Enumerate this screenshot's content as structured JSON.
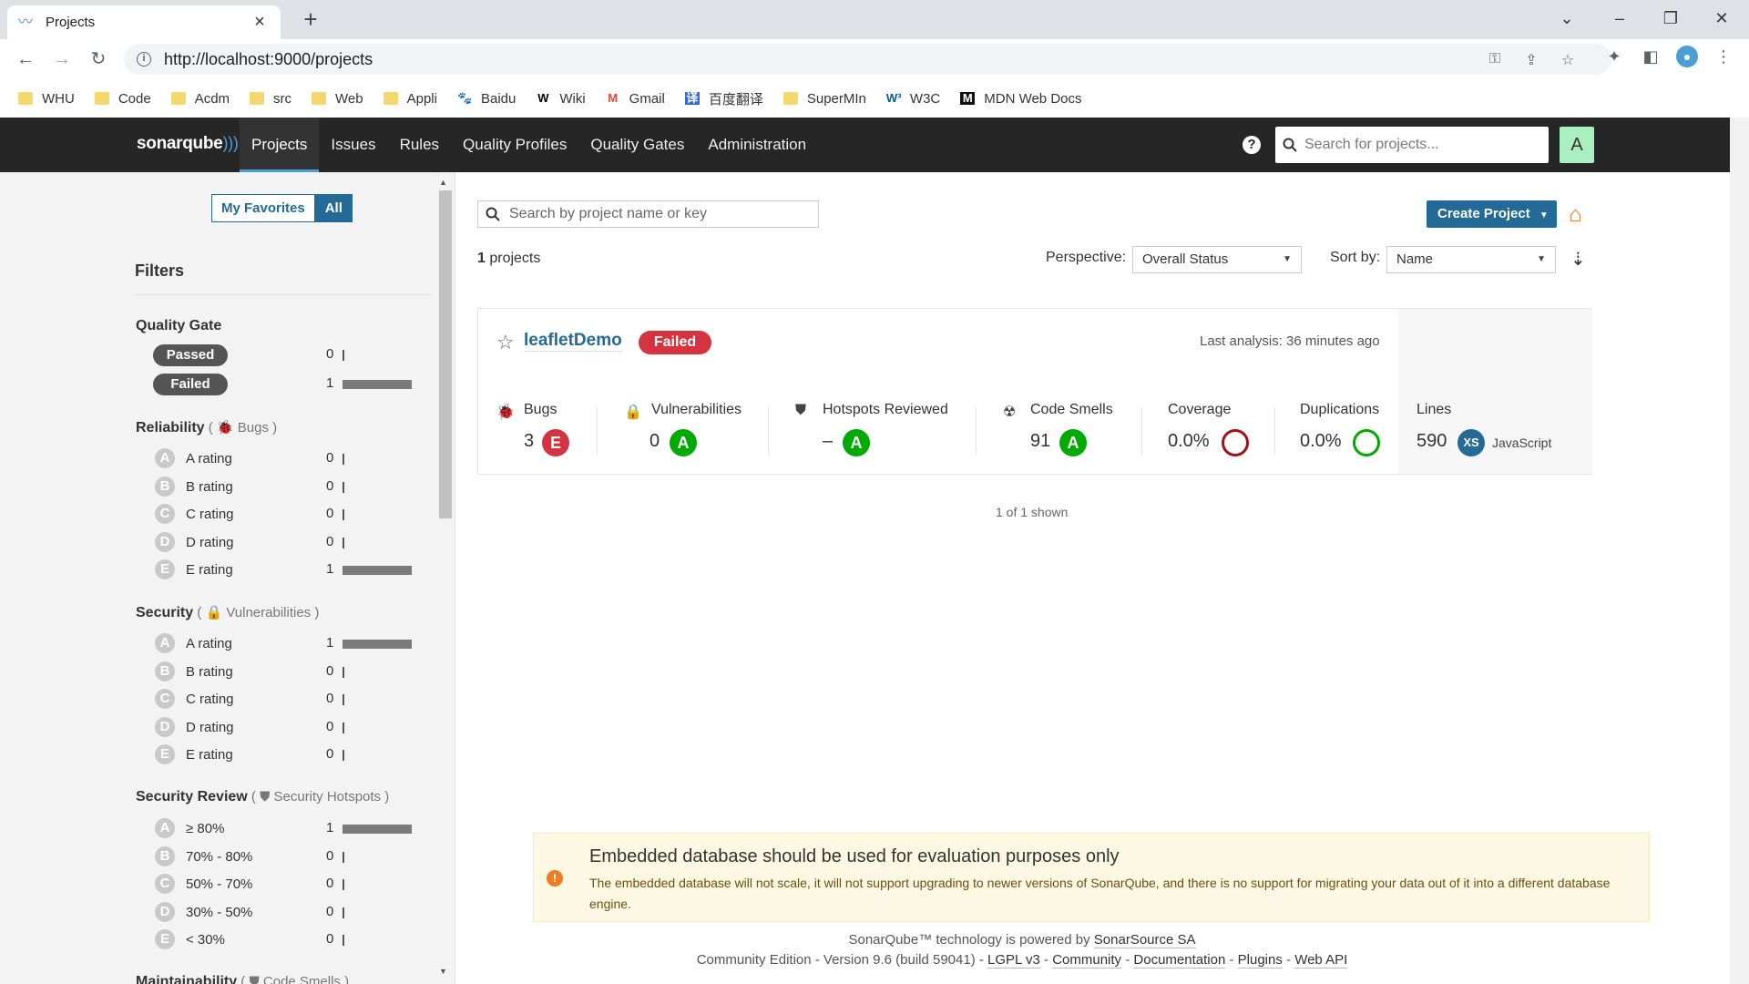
{
  "browser": {
    "tab_title": "Projects",
    "url": "http://localhost:9000/projects",
    "bookmarks": [
      {
        "label": "WHU",
        "icon": "folder-icon"
      },
      {
        "label": "Code",
        "icon": "folder-icon"
      },
      {
        "label": "Acdm",
        "icon": "folder-icon"
      },
      {
        "label": "src",
        "icon": "folder-icon"
      },
      {
        "label": "Web",
        "icon": "folder-icon"
      },
      {
        "label": "Appli",
        "icon": "folder-icon"
      },
      {
        "label": "Baidu",
        "icon": "baidu-icon"
      },
      {
        "label": "Wiki",
        "icon": "wikipedia-icon"
      },
      {
        "label": "Gmail",
        "icon": "gmail-icon"
      },
      {
        "label": "百度翻译",
        "icon": "translate-icon"
      },
      {
        "label": "SuperMIn",
        "icon": "folder-icon"
      },
      {
        "label": "W3C",
        "icon": "w3c-icon"
      },
      {
        "label": "MDN Web Docs",
        "icon": "mdn-icon"
      }
    ]
  },
  "nav": {
    "logo": "sonarqube",
    "menu": [
      "Projects",
      "Issues",
      "Rules",
      "Quality Profiles",
      "Quality Gates",
      "Administration"
    ],
    "active": "Projects",
    "search_placeholder": "Search for projects...",
    "avatar_letter": "A"
  },
  "sidebar": {
    "favorites": "My Favorites",
    "all": "All",
    "filters_title": "Filters",
    "quality_gate": {
      "title": "Quality Gate",
      "items": [
        {
          "label": "Passed",
          "count": "0",
          "frac": 0
        },
        {
          "label": "Failed",
          "count": "1",
          "frac": 1
        }
      ]
    },
    "reliability": {
      "title": "Reliability",
      "sub": "Bugs",
      "items": [
        {
          "letter": "A",
          "label": "A rating",
          "count": "0",
          "frac": 0
        },
        {
          "letter": "B",
          "label": "B rating",
          "count": "0",
          "frac": 0
        },
        {
          "letter": "C",
          "label": "C rating",
          "count": "0",
          "frac": 0
        },
        {
          "letter": "D",
          "label": "D rating",
          "count": "0",
          "frac": 0
        },
        {
          "letter": "E",
          "label": "E rating",
          "count": "1",
          "frac": 1
        }
      ]
    },
    "security": {
      "title": "Security",
      "sub": "Vulnerabilities",
      "items": [
        {
          "letter": "A",
          "label": "A rating",
          "count": "1",
          "frac": 1
        },
        {
          "letter": "B",
          "label": "B rating",
          "count": "0",
          "frac": 0
        },
        {
          "letter": "C",
          "label": "C rating",
          "count": "0",
          "frac": 0
        },
        {
          "letter": "D",
          "label": "D rating",
          "count": "0",
          "frac": 0
        },
        {
          "letter": "E",
          "label": "E rating",
          "count": "0",
          "frac": 0
        }
      ]
    },
    "security_review": {
      "title": "Security Review",
      "sub": "Security Hotspots",
      "items": [
        {
          "letter": "A",
          "label": "≥ 80%",
          "count": "1",
          "frac": 1
        },
        {
          "letter": "B",
          "label": "70% - 80%",
          "count": "0",
          "frac": 0
        },
        {
          "letter": "C",
          "label": "50% - 70%",
          "count": "0",
          "frac": 0
        },
        {
          "letter": "D",
          "label": "30% - 50%",
          "count": "0",
          "frac": 0
        },
        {
          "letter": "E",
          "label": "< 30%",
          "count": "0",
          "frac": 0
        }
      ]
    },
    "maintainability": {
      "title": "Maintainability",
      "sub": "Code Smells"
    }
  },
  "main": {
    "search_placeholder": "Search by project name or key",
    "create_project": "Create Project",
    "count": "1",
    "count_suffix": " projects",
    "perspective_label": "Perspective:",
    "perspective_value": "Overall Status",
    "sort_label": "Sort by:",
    "sort_value": "Name",
    "shown": "1 of 1 shown"
  },
  "project": {
    "name": "leafletDemo",
    "status": "Failed",
    "last_analysis": "Last analysis: 36 minutes ago",
    "bugs": {
      "label": "Bugs",
      "value": "3",
      "rating": "E"
    },
    "vulnerabilities": {
      "label": "Vulnerabilities",
      "value": "0",
      "rating": "A"
    },
    "hotspots": {
      "label": "Hotspots Reviewed",
      "value": "–",
      "rating": "A"
    },
    "code_smells": {
      "label": "Code Smells",
      "value": "91",
      "rating": "A"
    },
    "coverage": {
      "label": "Coverage",
      "value": "0.0%"
    },
    "duplications": {
      "label": "Duplications",
      "value": "0.0%"
    },
    "lines": {
      "label": "Lines",
      "value": "590",
      "size": "XS",
      "language": "JavaScript"
    }
  },
  "warning": {
    "title": "Embedded database should be used for evaluation purposes only",
    "text": "The embedded database will not scale, it will not support upgrading to newer versions of SonarQube, and there is no support for migrating your data out of it into a different database engine."
  },
  "footer": {
    "powered_prefix": "SonarQube™ technology is powered by ",
    "powered_link": "SonarSource SA",
    "edition": "Community Edition - Version 9.6 (build 59041) - ",
    "links": [
      "LGPL v3",
      "Community",
      "Documentation",
      "Plugins",
      "Web API"
    ]
  }
}
